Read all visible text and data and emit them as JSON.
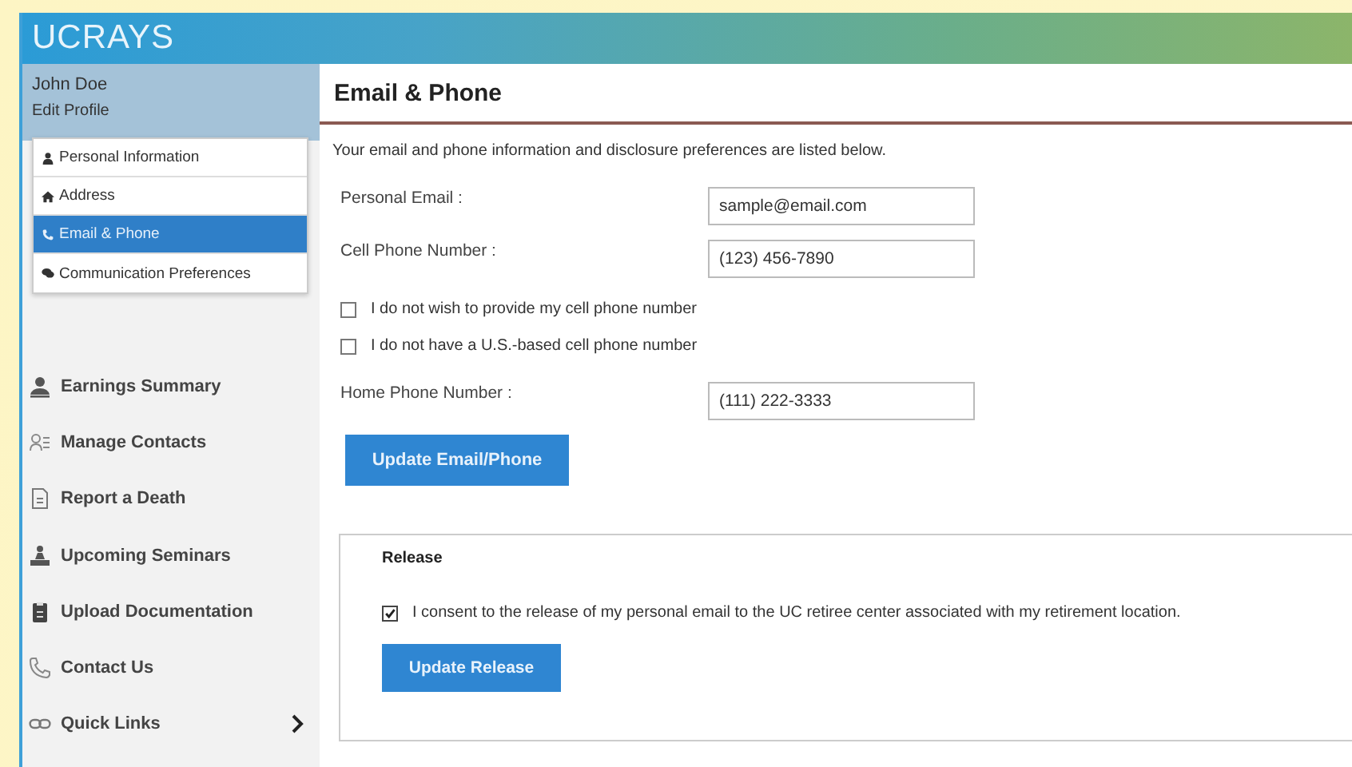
{
  "header": {
    "title": "UCRAYS"
  },
  "profile": {
    "name": "John Doe",
    "edit_label": "Edit Profile"
  },
  "profile_menu": [
    {
      "label": "Personal Information",
      "selected": false
    },
    {
      "label": "Address",
      "selected": false
    },
    {
      "label": "Email & Phone",
      "selected": true
    },
    {
      "label": "Communication Preferences",
      "selected": false
    }
  ],
  "nav": [
    {
      "label": "Earnings Summary",
      "has_submenu": false
    },
    {
      "label": "Manage Contacts",
      "has_submenu": false
    },
    {
      "label": "Report a Death",
      "has_submenu": false
    },
    {
      "label": "Upcoming Seminars",
      "has_submenu": false
    },
    {
      "label": "Upload Documentation",
      "has_submenu": false
    },
    {
      "label": "Contact Us",
      "has_submenu": false
    },
    {
      "label": "Quick Links",
      "has_submenu": true
    }
  ],
  "page": {
    "title": "Email & Phone",
    "intro": "Your email and phone information and disclosure preferences are listed below."
  },
  "fields": [
    {
      "label": "Personal Email :",
      "value": "sample@email.com"
    },
    {
      "label": "Cell Phone Number :",
      "value": "(123) 456-7890"
    }
  ],
  "options": [
    {
      "label": "I do not wish to provide my cell phone number",
      "checked": false
    },
    {
      "label": "I do not have a U.S.-based cell phone number",
      "checked": false
    }
  ],
  "home_field": {
    "label": "Home Phone Number :",
    "value": "(111) 222-3333"
  },
  "update_button": "Update Email/Phone",
  "release": {
    "title": "Release",
    "consent": {
      "label": "I consent to the release of my personal email to the UC retiree center associated with my retirement location.",
      "checked": true
    },
    "button": "Update Release"
  }
}
